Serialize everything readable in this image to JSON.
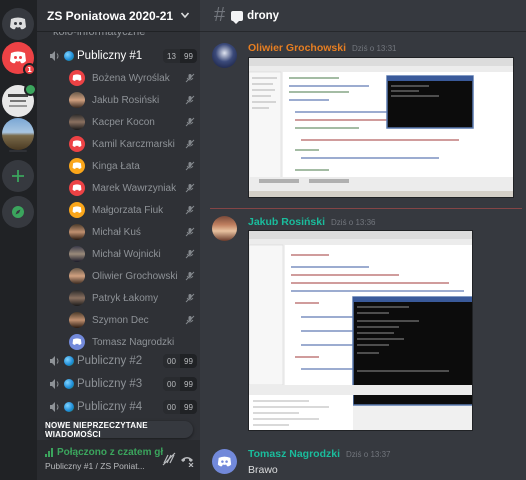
{
  "guild": {
    "name": "ZS Poniatowa 2020-21"
  },
  "servers": [
    {
      "name": "home",
      "badge": ""
    },
    {
      "name": "discord",
      "badge": "1"
    },
    {
      "name": "server-3",
      "badge": ""
    },
    {
      "name": "server-4",
      "badge": ""
    }
  ],
  "rail_actions": {
    "add": "add-server",
    "explore": "explore-servers"
  },
  "channels": {
    "partial_above": "koło-informatyczne",
    "voice": [
      {
        "name": "Publiczny #1",
        "count_a": "13",
        "count_b": "99",
        "active": true
      },
      {
        "name": "Publiczny #2",
        "count_a": "00",
        "count_b": "99"
      },
      {
        "name": "Publiczny #3",
        "count_a": "00",
        "count_b": "99"
      },
      {
        "name": "Publiczny #4",
        "count_a": "00",
        "count_b": "99"
      }
    ],
    "members": [
      {
        "name": "Bożena Wyroślak",
        "avatar": "#ed4245"
      },
      {
        "name": "Jakub Rosiński",
        "avatar": "photo"
      },
      {
        "name": "Kacper Kocon",
        "avatar": "photo"
      },
      {
        "name": "Kamil Karczmarski",
        "avatar": "#ed4245"
      },
      {
        "name": "Kinga Łata",
        "avatar": "#faa61a"
      },
      {
        "name": "Marek Wawrzyniak",
        "avatar": "#ed4245"
      },
      {
        "name": "Małgorzata Fiuk",
        "avatar": "#faa61a"
      },
      {
        "name": "Michał Kuś",
        "avatar": "photo"
      },
      {
        "name": "Michał Wojnicki",
        "avatar": "photo"
      },
      {
        "name": "Oliwier Grochowski",
        "avatar": "photo"
      },
      {
        "name": "Patryk Łakomy",
        "avatar": "photo"
      },
      {
        "name": "Szymon Dec",
        "avatar": "photo"
      },
      {
        "name": "Tomasz Nagrodzki",
        "avatar": "#7289da"
      }
    ]
  },
  "unread_banner": "NOWE NIEPRZECZYTANE WIADOMOŚCI",
  "voice_panel": {
    "status": "Połączono z czatem gł",
    "subtitle": "Publiczny #1 / ZS Poniat..."
  },
  "chat": {
    "channel_name": "drony",
    "messages": [
      {
        "author": "Oliwier Grochowski",
        "author_color": "#e67e22",
        "time": "Dziś o 13:31",
        "text": "",
        "has_attachment": true
      },
      {
        "author": "Jakub Rosiński",
        "author_color": "#1abc9c",
        "time": "Dziś o 13:36",
        "text": "",
        "has_attachment": true
      },
      {
        "author": "Tomasz Nagrodzki",
        "author_color": "#1abc9c",
        "time": "Dziś o 13:37",
        "text": "Brawo",
        "has_attachment": false
      }
    ]
  }
}
